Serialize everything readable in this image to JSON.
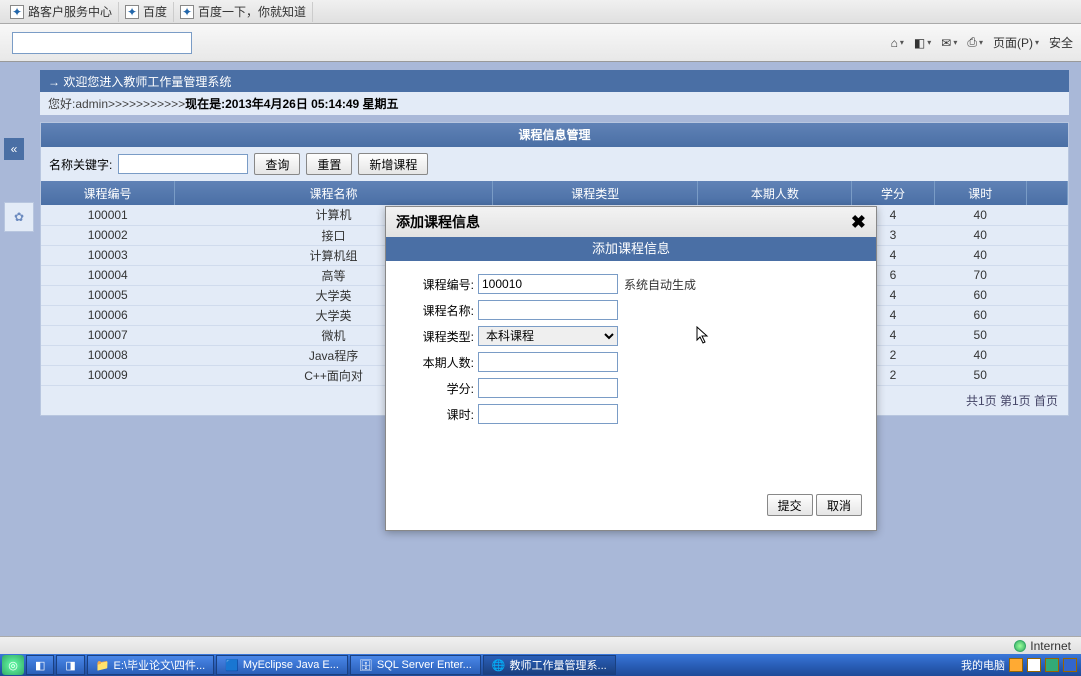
{
  "tabs": [
    {
      "fav": "✦",
      "label": "路客户服务中心"
    },
    {
      "fav": "✦",
      "label": "百度"
    },
    {
      "fav": "✦",
      "label": "百度一下，你就知道"
    }
  ],
  "toolbar_right": {
    "page": "页面(P)",
    "safe": "安全"
  },
  "welcome": "→ 欢迎您进入教师工作量管理系统",
  "greet_prefix": "您好:admin>>>>>>>>>>> ",
  "greet_now_label": "现在是:",
  "greet_now": "2013年4月26日  05:14:49 星期五",
  "panel_title": "课程信息管理",
  "search": {
    "label": "名称关键字:",
    "btn_query": "查询",
    "btn_reset": "重置",
    "btn_add": "新增课程"
  },
  "columns": [
    "课程编号",
    "课程名称",
    "课程类型",
    "本期人数",
    "学分",
    "课时"
  ],
  "rows": [
    {
      "id": "100001",
      "name": "计算机",
      "credit": "4",
      "hour": "40"
    },
    {
      "id": "100002",
      "name": "接口",
      "credit": "3",
      "hour": "40"
    },
    {
      "id": "100003",
      "name": "计算机组",
      "credit": "4",
      "hour": "40"
    },
    {
      "id": "100004",
      "name": "高等",
      "credit": "6",
      "hour": "70"
    },
    {
      "id": "100005",
      "name": "大学英",
      "credit": "4",
      "hour": "60"
    },
    {
      "id": "100006",
      "name": "大学英",
      "credit": "4",
      "hour": "60"
    },
    {
      "id": "100007",
      "name": "微机",
      "credit": "4",
      "hour": "50"
    },
    {
      "id": "100008",
      "name": "Java程序",
      "credit": "2",
      "hour": "40"
    },
    {
      "id": "100009",
      "name": "C++面向对",
      "credit": "2",
      "hour": "50"
    }
  ],
  "pager": "共1页 第1页 首页",
  "dialog": {
    "title": "添加课程信息",
    "subtitle": "添加课程信息",
    "fields": {
      "id_label": "课程编号:",
      "id_value": "100010",
      "id_hint": "系统自动生成",
      "name_label": "课程名称:",
      "type_label": "课程类型:",
      "type_value": "本科课程",
      "count_label": "本期人数:",
      "credit_label": "学分:",
      "hour_label": "课时:"
    },
    "submit": "提交",
    "cancel": "取消"
  },
  "status": {
    "zone": "Internet"
  },
  "taskbar": {
    "items": [
      "E:\\毕业论文\\四件...",
      "MyEclipse Java E...",
      "SQL Server Enter...",
      "教师工作量管理系..."
    ],
    "tray": "我的电脑"
  }
}
